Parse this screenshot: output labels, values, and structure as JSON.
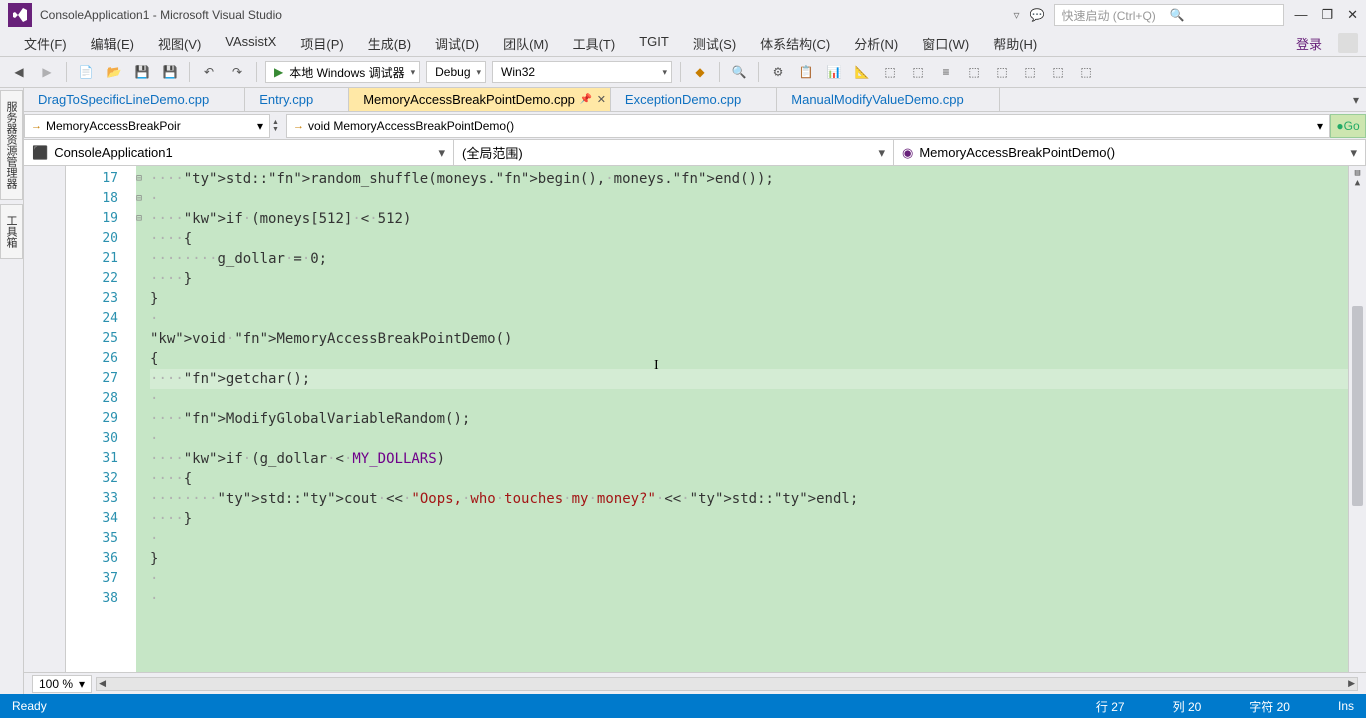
{
  "title": "ConsoleApplication1 - Microsoft Visual Studio",
  "quickLaunch": "快速启动 (Ctrl+Q)",
  "menu": [
    "文件(F)",
    "编辑(E)",
    "视图(V)",
    "VAssistX",
    "项目(P)",
    "生成(B)",
    "调试(D)",
    "团队(M)",
    "工具(T)",
    "TGIT",
    "测试(S)",
    "体系结构(C)",
    "分析(N)",
    "窗口(W)",
    "帮助(H)"
  ],
  "signin": "登录",
  "toolbar": {
    "debugger": "本地 Windows 调试器",
    "config": "Debug",
    "platform": "Win32"
  },
  "tabs": [
    {
      "label": "DragToSpecificLineDemo.cpp",
      "active": false
    },
    {
      "label": "Entry.cpp",
      "active": false
    },
    {
      "label": "MemoryAccessBreakPointDemo.cpp",
      "active": true,
      "pinned": true
    },
    {
      "label": "ExceptionDemo.cpp",
      "active": false
    },
    {
      "label": "ManualModifyValueDemo.cpp",
      "active": false
    }
  ],
  "nav": {
    "scope1": "MemoryAccessBreakPoir",
    "scope2": "void MemoryAccessBreakPointDemo()",
    "go": "Go"
  },
  "nav2": {
    "project": "ConsoleApplication1",
    "global": "(全局范围)",
    "func": "MemoryAccessBreakPointDemo()"
  },
  "sidebar": [
    "服务器资源管理器",
    "工具箱"
  ],
  "zoom": "100 %",
  "status": {
    "ready": "Ready",
    "line": "行 27",
    "col": "列 20",
    "char": "字符 20",
    "ins": "Ins"
  },
  "code": {
    "startLine": 17,
    "lines": [
      {
        "n": 17,
        "t": "    std::random_shuffle(moneys.begin(), moneys.end());"
      },
      {
        "n": 18,
        "t": ""
      },
      {
        "n": 19,
        "t": "    if (moneys[512] < 512)",
        "fold": "-"
      },
      {
        "n": 20,
        "t": "    {"
      },
      {
        "n": 21,
        "t": "        g_dollar = 0;"
      },
      {
        "n": 22,
        "t": "    }"
      },
      {
        "n": 23,
        "t": "}"
      },
      {
        "n": 24,
        "t": ""
      },
      {
        "n": 25,
        "t": "void MemoryAccessBreakPointDemo()",
        "fold": "-"
      },
      {
        "n": 26,
        "t": "{"
      },
      {
        "n": 27,
        "t": "    getchar();",
        "cur": true
      },
      {
        "n": 28,
        "t": ""
      },
      {
        "n": 29,
        "t": "    ModifyGlobalVariableRandom();"
      },
      {
        "n": 30,
        "t": ""
      },
      {
        "n": 31,
        "t": "    if (g_dollar < MY_DOLLARS)",
        "fold": "-"
      },
      {
        "n": 32,
        "t": "    {"
      },
      {
        "n": 33,
        "t": "        std::cout << \"Oops, who touches my money?\" << std::endl;"
      },
      {
        "n": 34,
        "t": "    }"
      },
      {
        "n": 35,
        "t": ""
      },
      {
        "n": 36,
        "t": "}"
      },
      {
        "n": 37,
        "t": ""
      },
      {
        "n": 38,
        "t": ""
      }
    ]
  }
}
